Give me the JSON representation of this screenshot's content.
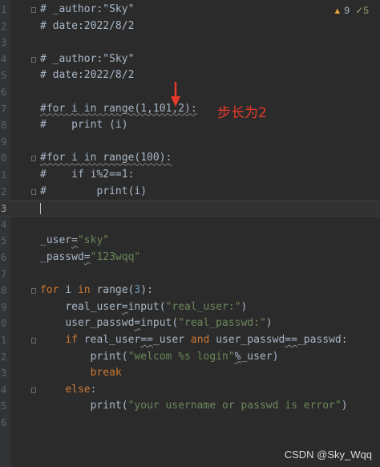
{
  "editor": {
    "inspection": {
      "warning_icon": "warning-triangle-icon",
      "warning_count": "9",
      "ok_icon": "check-icon",
      "ok_count": "5"
    },
    "annotation_text": "步长为2",
    "arrow_icon": "down-arrow-icon",
    "line_numbers": [
      "1",
      "2",
      "3",
      "4",
      "5",
      "6",
      "7",
      "8",
      "9",
      "0",
      "1",
      "2",
      "3",
      "4",
      "5",
      "6",
      "7",
      "8",
      "9",
      "0",
      "1",
      "2",
      "3",
      "4",
      "5",
      "6"
    ],
    "lines": [
      "# _author:\"Sky\"",
      "# date:2022/8/2",
      "",
      "# _author:\"Sky\"",
      "# date:2022/8/2",
      "",
      "#for i in range(1,101,2):",
      "#    print (i)",
      "",
      "#for i in range(100):",
      "#    if i%2==1:",
      "#        print(i)",
      "",
      "",
      "_user=\"sky\"",
      "_passwd=\"123wqq\"",
      "",
      "for i in range(3):",
      "    real_user=input(\"real_user:\")",
      "    user_passwd=input(\"real_passwd:\")",
      "    if real_user==_user and user_passwd==_passwd:",
      "        print(\"welcom %s login\"%_user)",
      "        break",
      "    else:",
      "        print(\"your username or passwd is error\")",
      ""
    ]
  },
  "colors": {
    "background": "#2b2b2b",
    "keyword": "#cc7832",
    "string": "#6a8759",
    "number": "#6897bb",
    "text": "#a9b7c6",
    "annotation": "#e83a2c"
  },
  "watermark": "CSDN @Sky_Wqq"
}
